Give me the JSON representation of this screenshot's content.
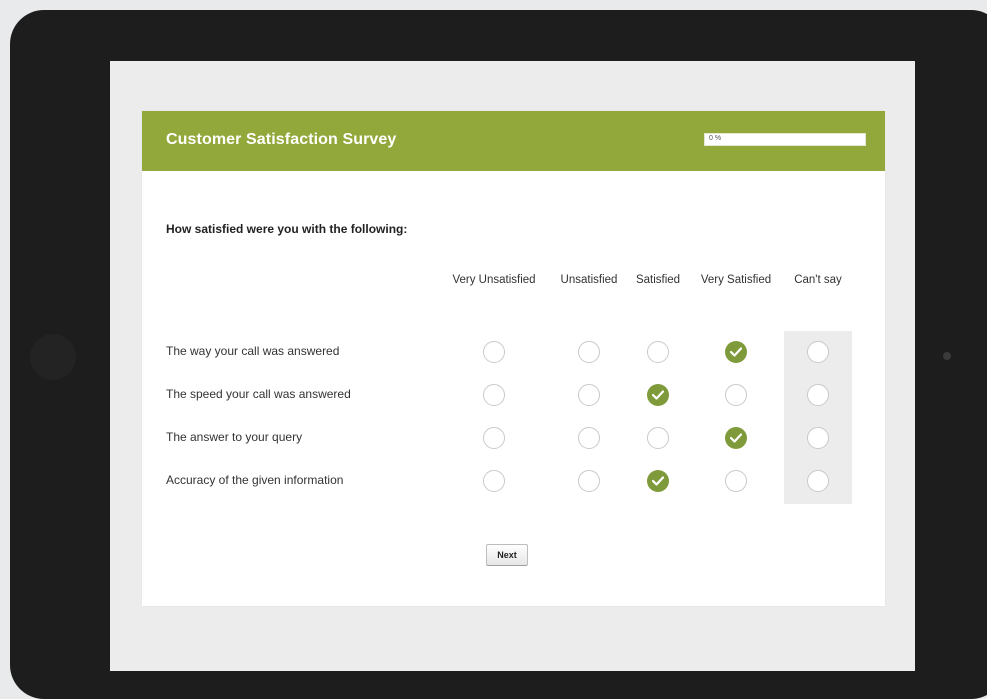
{
  "survey": {
    "title": "Customer Satisfaction Survey",
    "progress_text": "0 %",
    "progress_value": 0,
    "question": "How satisfied were you with the following:",
    "columns": [
      "Very Unsatisfied",
      "Unsatisfied",
      "Satisfied",
      "Very Satisfied",
      "Can't say"
    ],
    "rows": [
      {
        "label": "The way your call was answered",
        "selected": "Very Satisfied"
      },
      {
        "label": "The speed your call was answered",
        "selected": "Satisfied"
      },
      {
        "label": "The answer to your query",
        "selected": "Very Satisfied"
      },
      {
        "label": "Accuracy of the given information",
        "selected": "Satisfied"
      }
    ],
    "next_label": "Next"
  },
  "colors": {
    "header": "#93a83a",
    "selected": "#7f9a3a",
    "tablet_frame": "#1d1d1d"
  },
  "icons": {
    "checked_radio": "check-icon"
  }
}
